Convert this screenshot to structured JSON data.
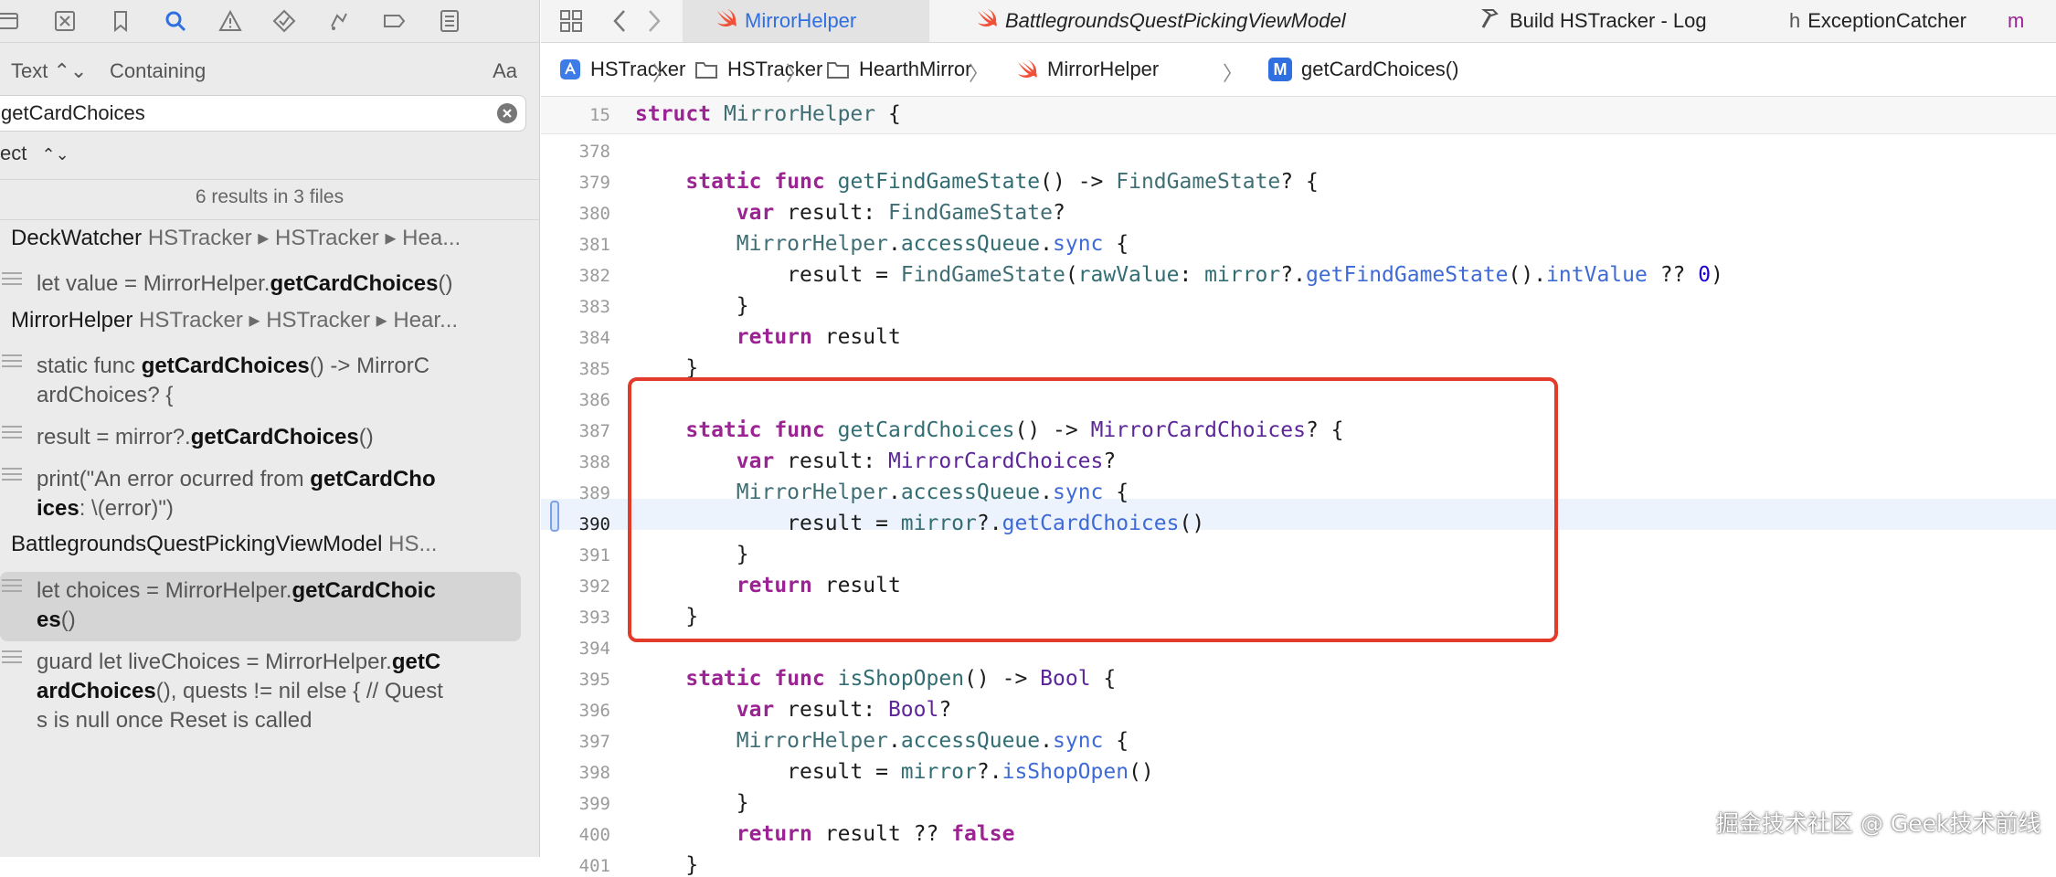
{
  "navigator": {
    "query_mode": {
      "kind": "Text",
      "match": "Containing",
      "case_label": "Aa"
    },
    "search": {
      "value": "getCardChoices"
    },
    "scope": {
      "label": "ect"
    },
    "summary": "6 results in 3 files",
    "results": [
      {
        "type": "file",
        "name": "DeckWatcher",
        "path": "HSTracker ▸ HSTracker ▸ Hea..."
      },
      {
        "type": "match",
        "lines": [
          "let value = MirrorHelper.<b>getCardChoices</b>()"
        ]
      },
      {
        "type": "file",
        "name": "MirrorHelper",
        "path": "HSTracker ▸ HSTracker ▸ Hear..."
      },
      {
        "type": "match",
        "lines": [
          "static func <b>getCardChoices</b>() -> MirrorC",
          "ardChoices? {"
        ]
      },
      {
        "type": "match",
        "lines": [
          "result = mirror?.<b>getCardChoices</b>()"
        ]
      },
      {
        "type": "match",
        "lines": [
          "print(\"An error ocurred from <b>getCardCho</b>",
          "<b>ices</b>: \\(error)\")"
        ]
      },
      {
        "type": "file",
        "name": "BattlegroundsQuestPickingViewModel",
        "path": "HS..."
      },
      {
        "type": "match",
        "selected": true,
        "lines": [
          "let choices = MirrorHelper.<b>getCardChoic</b>",
          "<b>es</b>()"
        ]
      },
      {
        "type": "match",
        "lines": [
          "guard let liveChoices = MirrorHelper.<b>getC</b>",
          "<b>ardChoices</b>(), quests != nil else { // Quest",
          "s is null once Reset is called"
        ]
      }
    ]
  },
  "tabs": [
    {
      "label": "MirrorHelper",
      "icon": "swift-icon",
      "active": true,
      "italic": false
    },
    {
      "label": "BattlegroundsQuestPickingViewModel",
      "icon": "swift-icon",
      "active": false,
      "italic": true
    },
    {
      "label": "Build HSTracker - Log",
      "icon": "hammer-icon",
      "active": false,
      "italic": false
    },
    {
      "label": "ExceptionCatcher",
      "icon": "header-h-icon",
      "icon_text": "h",
      "active": false,
      "italic": false
    },
    {
      "label": "m",
      "icon": "",
      "active": false,
      "italic": false
    }
  ],
  "breadcrumb": [
    {
      "label": "HSTracker",
      "icon": "app-target-icon"
    },
    {
      "label": "HSTracker",
      "icon": "folder-icon"
    },
    {
      "label": "HearthMirror",
      "icon": "folder-icon"
    },
    {
      "label": "MirrorHelper",
      "icon": "swift-icon"
    },
    {
      "label": "getCardChoices()",
      "icon": "method-icon",
      "icon_text": "M"
    }
  ],
  "breadcrumb_separator": "〉",
  "sticky": {
    "line": "15",
    "html": "<span class=\"kw\">struct</span> <span class=\"ty\">MirrorHelper</span> {"
  },
  "code_lines": [
    {
      "n": "378",
      "html": ""
    },
    {
      "n": "379",
      "html": "    <span class=\"kw\">static</span> <span class=\"kw\">func</span> <span class=\"fn\">getFindGameState</span>() -> <span class=\"ty\">FindGameState</span>? {"
    },
    {
      "n": "380",
      "html": "        <span class=\"kw\">var</span> result: <span class=\"ty\">FindGameState</span>?"
    },
    {
      "n": "381",
      "html": "        <span class=\"ty\">MirrorHelper</span>.<span class=\"fn\">accessQueue</span>.<span class=\"pfn\">sync</span> {"
    },
    {
      "n": "382",
      "html": "            result = <span class=\"ty\">FindGameState</span>(<span class=\"fn\">rawValue</span>: <span class=\"fn\">mirror</span>?.<span class=\"pfn\">getFindGameState</span>().<span class=\"pfn\">intValue</span> ?? <span class=\"num\">0</span>)"
    },
    {
      "n": "383",
      "html": "        }"
    },
    {
      "n": "384",
      "html": "        <span class=\"kw\">return</span> result"
    },
    {
      "n": "385",
      "html": "    }"
    },
    {
      "n": "386",
      "html": ""
    },
    {
      "n": "387",
      "html": "    <span class=\"kw\">static</span> <span class=\"kw\">func</span> <span class=\"fn\">getCardChoices</span>() -> <span class=\"pty\">MirrorCardChoices</span>? {"
    },
    {
      "n": "388",
      "html": "        <span class=\"kw\">var</span> result: <span class=\"pty\">MirrorCardChoices</span>?"
    },
    {
      "n": "389",
      "html": "        <span class=\"ty\">MirrorHelper</span>.<span class=\"fn\">accessQueue</span>.<span class=\"pfn\">sync</span> {"
    },
    {
      "n": "390",
      "html": "            result = <span class=\"fn\">mirror</span>?.<span class=\"pfn\">getCardChoices</span>()",
      "current": true
    },
    {
      "n": "391",
      "html": "        }"
    },
    {
      "n": "392",
      "html": "        <span class=\"kw\">return</span> result"
    },
    {
      "n": "393",
      "html": "    }"
    },
    {
      "n": "394",
      "html": ""
    },
    {
      "n": "395",
      "html": "    <span class=\"kw\">static</span> <span class=\"kw\">func</span> <span class=\"fn\">isShopOpen</span>() -> <span class=\"pty\">Bool</span> {"
    },
    {
      "n": "396",
      "html": "        <span class=\"kw\">var</span> result: <span class=\"pty\">Bool</span>?"
    },
    {
      "n": "397",
      "html": "        <span class=\"ty\">MirrorHelper</span>.<span class=\"fn\">accessQueue</span>.<span class=\"pfn\">sync</span> {"
    },
    {
      "n": "398",
      "html": "            result = <span class=\"fn\">mirror</span>?.<span class=\"pfn\">isShopOpen</span>()"
    },
    {
      "n": "399",
      "html": "        }"
    },
    {
      "n": "400",
      "html": "        <span class=\"kw\">return</span> result ?? <span class=\"kw\">false</span>"
    },
    {
      "n": "401",
      "html": "    }"
    }
  ],
  "watermark": "掘金技术社区 @ Geek技术前线",
  "colors": {
    "highlight_box": "#e23b2a",
    "active_tab": "#2f6fe0",
    "keyword": "#9b2393"
  }
}
